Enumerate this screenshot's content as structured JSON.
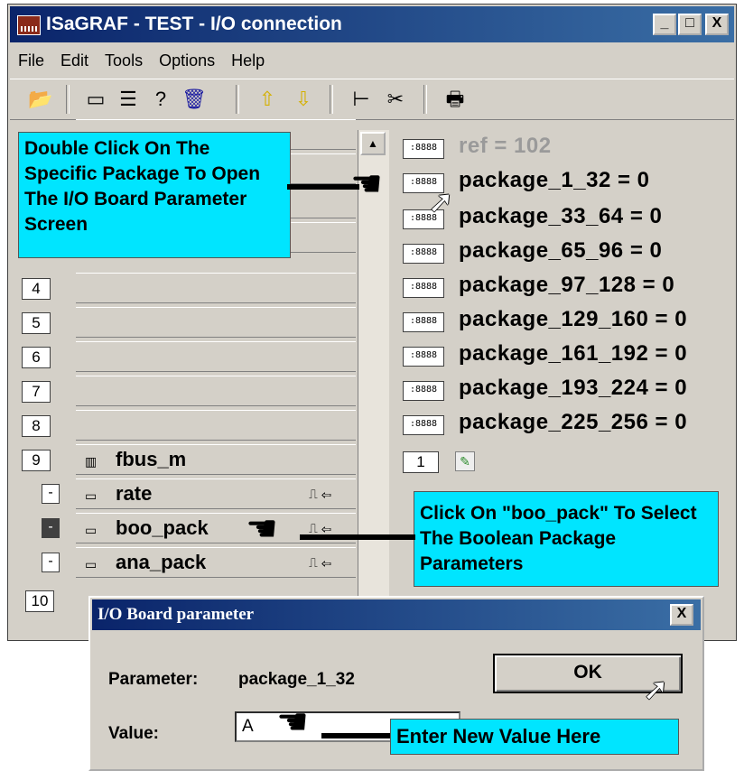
{
  "window": {
    "title": "ISaGRAF - TEST - I/O connection",
    "controls": {
      "minimize": "_",
      "maximize": "□",
      "close": "X"
    }
  },
  "menu": [
    "File",
    "Edit",
    "Tools",
    "Options",
    "Help"
  ],
  "toolbar_icons": [
    "open-icon",
    "edit-icon",
    "list-icon",
    "help-icon",
    "delete-icon",
    "up-arrow-icon",
    "down-arrow-icon",
    "connect-icon",
    "cut-icon",
    "print-icon"
  ],
  "left_rows": {
    "r4": "4",
    "r5": "5",
    "r6": "6",
    "r7": "7",
    "r8": "8",
    "r9": {
      "num": "9",
      "label": "fbus_m"
    },
    "sub1": {
      "mark": "-",
      "label": "rate"
    },
    "sub2": {
      "mark": "-",
      "label": "boo_pack"
    },
    "sub3": {
      "mark": "-",
      "label": "ana_pack"
    },
    "r10": "10"
  },
  "right_items": {
    "ref": "ref = 102",
    "p1": "package_1_32 = 0",
    "p2": "package_33_64 = 0",
    "p3": "package_65_96 = 0",
    "p4": "package_97_128 = 0",
    "p5": "package_129_160 = 0",
    "p6": "package_161_192 = 0",
    "p7": "package_193_224 = 0",
    "p8": "package_225_256 = 0",
    "counter": "1",
    "icon_text": ":8888"
  },
  "callouts": {
    "double_click": "Double Click On The Specific Package To Open The I/O Board Parameter Screen",
    "boo_pack": "Click On \"boo_pack\" To Select The Boolean Package Parameters",
    "enter_value": "Enter New Value Here"
  },
  "dialog": {
    "title": "I/O Board parameter",
    "close": "X",
    "parameter_label": "Parameter:",
    "parameter_value": "package_1_32",
    "value_label": "Value:",
    "value_input": "A",
    "ok": "OK"
  },
  "colors": {
    "callout": "#00e5ff",
    "titlebar": "#0a246a",
    "window": "#d4d0c8"
  }
}
